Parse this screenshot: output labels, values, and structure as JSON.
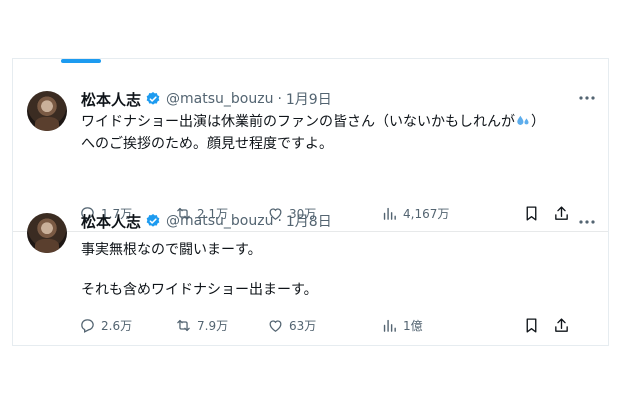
{
  "tweets": [
    {
      "name": "松本人志",
      "handle": "@matsu_bouzu",
      "separator": "·",
      "date": "1月9日",
      "lines": [
        "ワイドナショー出演は休業前のファンの皆さん（いないかもしれんが",
        "）",
        "へのご挨拶のため。顔見せ程度ですよ。"
      ],
      "stats": {
        "replies": "1.7万",
        "retweets": "2.1万",
        "likes": "30万",
        "views": "4,167万"
      }
    },
    {
      "name": "松本人志",
      "handle": "@matsu_bouzu",
      "separator": "·",
      "date": "1月8日",
      "lines": [
        "事実無根なので闘いまーす。",
        "それも含めワイドナショー出まーす。"
      ],
      "stats": {
        "replies": "2.6万",
        "retweets": "7.9万",
        "likes": "63万",
        "views": "1億"
      }
    }
  ],
  "icons": [
    "verified-badge-icon",
    "more-options-icon",
    "reply-icon",
    "retweet-icon",
    "like-icon",
    "views-icon",
    "bookmark-icon",
    "share-icon",
    "sweat-droplets-emoji"
  ],
  "colors": {
    "accent": "#1d9bf0",
    "muted": "#536471",
    "text": "#0f1419",
    "border": "#e7e9ea"
  }
}
